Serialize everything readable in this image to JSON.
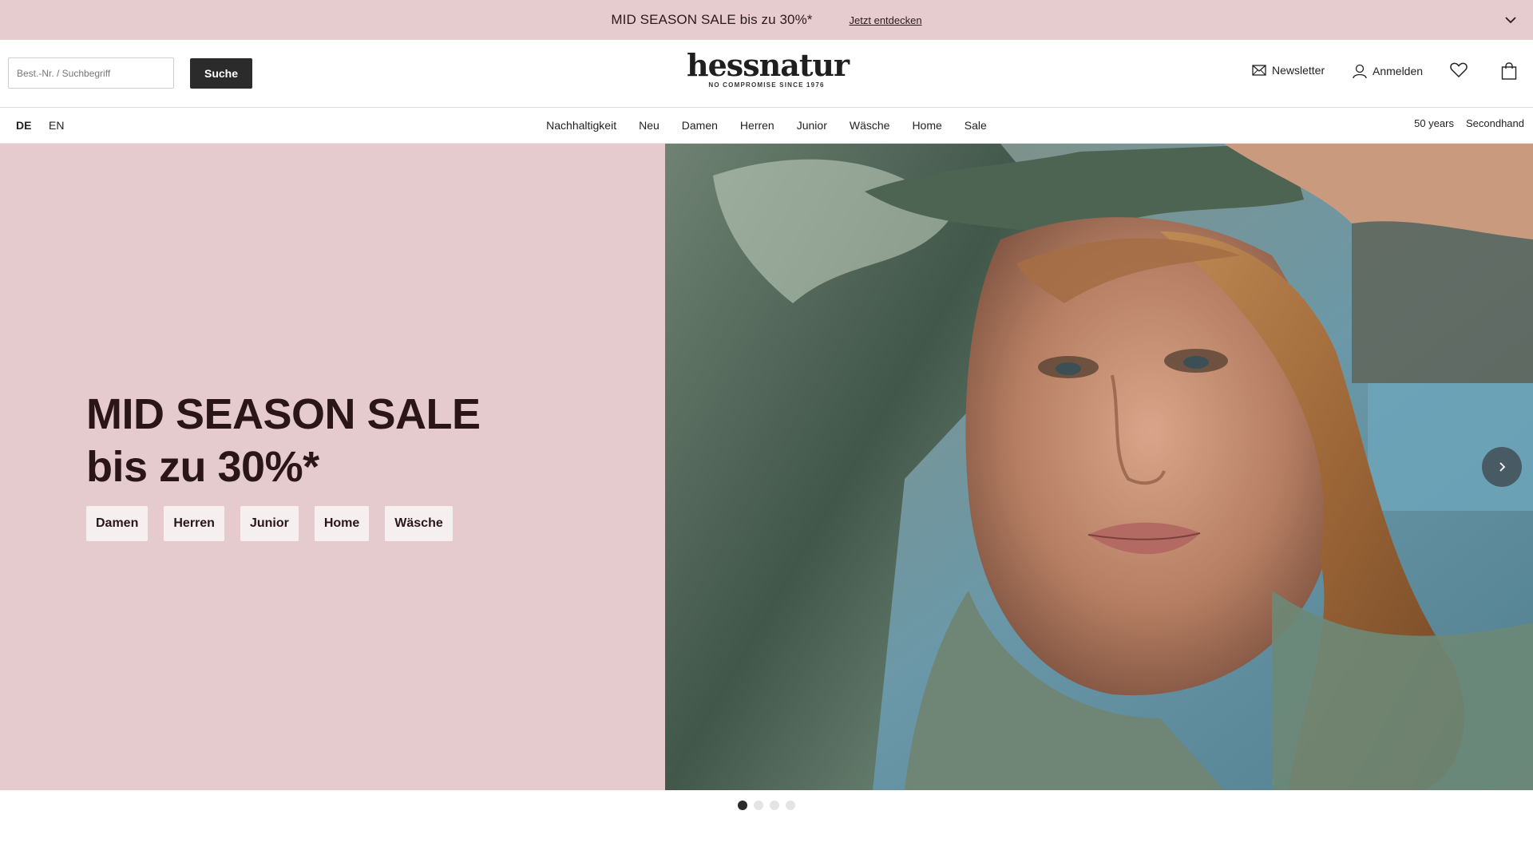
{
  "promo": {
    "text": "MID SEASON SALE bis zu 30%*",
    "link": "Jetzt entdecken",
    "background": "#e7cccf"
  },
  "header": {
    "search_placeholder": "Best.-Nr. / Suchbegriff",
    "search_button": "Suche",
    "logo_text": "hessnatur",
    "logo_tagline": "NO COMPROMISE SINCE 1976",
    "newsletter": "Newsletter",
    "login": "Anmelden",
    "icons": [
      "mail-icon",
      "user-icon",
      "heart-icon",
      "shopping-bag-icon"
    ]
  },
  "nav": {
    "lang_de": "DE",
    "lang_en": "EN",
    "items": [
      "Nachhaltigkeit",
      "Neu",
      "Damen",
      "Herren",
      "Junior",
      "Wäsche",
      "Home",
      "Sale"
    ],
    "right": [
      "50 years",
      "Secondhand"
    ]
  },
  "hero": {
    "title_line1": "MID SEASON SALE",
    "title_line2": "bis zu 30%*",
    "categories": [
      "Damen",
      "Herren",
      "Junior",
      "Home",
      "Wäsche"
    ],
    "left_background": "#e6cbce",
    "text_color": "#2a1619"
  },
  "carousel": {
    "slide_count": 4,
    "active_slide": 1
  }
}
